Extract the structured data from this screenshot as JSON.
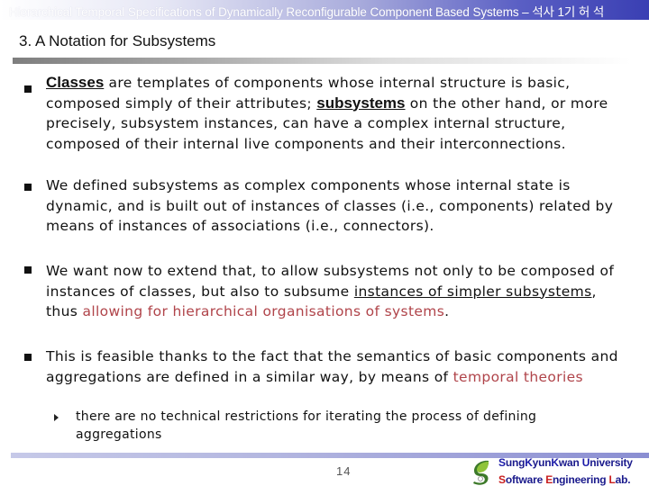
{
  "header": {
    "title": "Hierarchical Temporal Specifications of Dynamically Reconfigurable Component Based Systems – 석사 1기 허 석"
  },
  "slide": {
    "title": "3. A Notation for Subsystems",
    "bullets": [
      {
        "parts": [
          {
            "text": "Classes",
            "style": "em-bold"
          },
          {
            "text": " are templates of components whose internal structure is basic, composed simply of their attributes; ",
            "style": ""
          },
          {
            "text": "subsystems",
            "style": "em-bold"
          },
          {
            "text": " on the other hand, or more precisely, subsystem instances, can have a complex internal structure, composed of their internal live components and their interconnections.",
            "style": ""
          }
        ]
      },
      {
        "parts": [
          {
            "text": "We defined subsystems as complex components whose internal state is dynamic, and is built out of instances of classes (i.e., components) related by means of instances of associations (i.e., connectors).",
            "style": ""
          }
        ]
      },
      {
        "parts": [
          {
            "text": "We want now to extend that, to allow subsystems not only to be composed of instances of classes, but also to subsume ",
            "style": ""
          },
          {
            "text": "instances of simpler subsystems",
            "style": "ul"
          },
          {
            "text": ", thus ",
            "style": ""
          },
          {
            "text": "allowing for hierarchical organisations of systems",
            "style": "red"
          },
          {
            "text": ".",
            "style": ""
          }
        ]
      },
      {
        "parts": [
          {
            "text": "This is feasible thanks to the fact that the semantics of basic components and aggregations are defined in a similar way, by means of ",
            "style": ""
          },
          {
            "text": "temporal theories",
            "style": "red"
          }
        ],
        "sub_bullets": [
          "there are no technical restrictions for iterating the process of defining aggregations"
        ]
      }
    ]
  },
  "footer": {
    "page_number": "14",
    "logo_icon": "skku-logo-icon",
    "university_line": [
      {
        "text": "S",
        "cap": true
      },
      {
        "text": "ung",
        "cap": false
      },
      {
        "text": "K",
        "cap": true
      },
      {
        "text": "yun",
        "cap": false
      },
      {
        "text": "K",
        "cap": true
      },
      {
        "text": "wan ",
        "cap": false
      },
      {
        "text": "U",
        "cap": true
      },
      {
        "text": "niversity",
        "cap": false
      }
    ],
    "lab_line": [
      {
        "text": "S",
        "cap": true
      },
      {
        "text": "oftware ",
        "cap": false
      },
      {
        "text": "E",
        "cap": true
      },
      {
        "text": "ngineering ",
        "cap": false
      },
      {
        "text": "L",
        "cap": true
      },
      {
        "text": "ab.",
        "cap": false
      }
    ]
  },
  "colors": {
    "highlight_red": "#b0444a",
    "logo_blue": "#1a1a8c",
    "logo_red": "#c81e1e",
    "header_gradient_end": "#3a3fb3"
  }
}
